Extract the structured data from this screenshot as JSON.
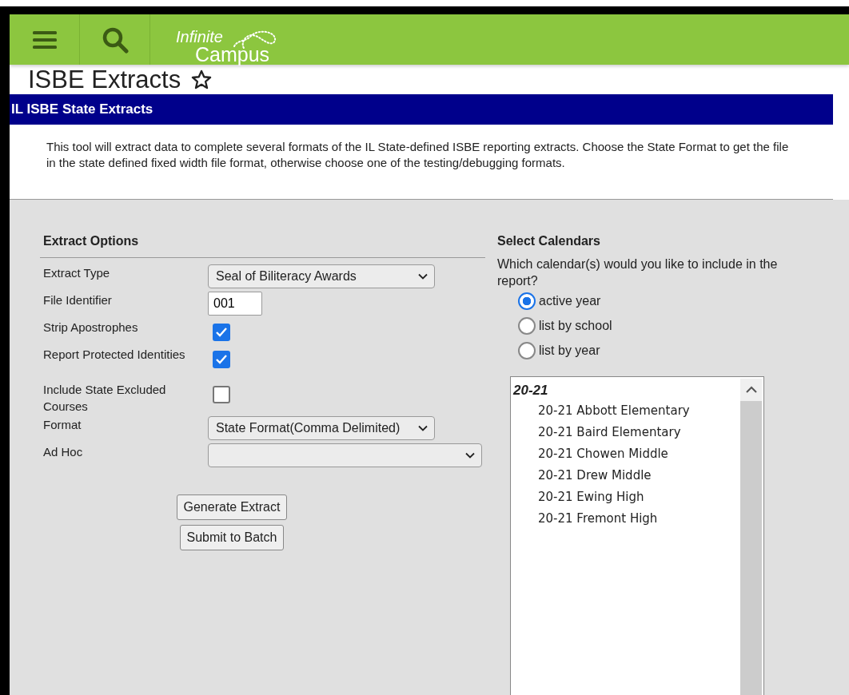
{
  "header": {
    "logo_line1": "Infinite",
    "logo_line2": "Campus"
  },
  "page": {
    "title": "ISBE Extracts",
    "favorited": false
  },
  "panel": {
    "title": "IL ISBE State Extracts",
    "description": "This tool will extract data to complete several formats of the IL State-defined ISBE reporting extracts. Choose the State Format to get the file in the state defined fixed width file format, otherwise choose one of the testing/debugging formats."
  },
  "extract_options": {
    "heading": "Extract Options",
    "fields": [
      {
        "kind": "select",
        "label": "Extract Type",
        "value": "Seal of Biliteracy Awards"
      },
      {
        "kind": "text",
        "label": "File Identifier",
        "value": "001"
      },
      {
        "kind": "checkbox",
        "label": "Strip Apostrophes",
        "checked": true
      },
      {
        "kind": "checkbox",
        "label": "Report Protected Identities",
        "checked": true
      },
      {
        "kind": "checkbox",
        "label": "Include State Excluded Courses",
        "checked": false
      },
      {
        "kind": "select",
        "label": "Format",
        "value": "State Format(Comma Delimited)"
      },
      {
        "kind": "select",
        "label": "Ad Hoc"
      }
    ],
    "buttons": [
      "Generate Extract",
      "Submit to Batch"
    ]
  },
  "calendars": {
    "heading": "Select Calendars",
    "question": "Which calendar(s) would you like to include in the report?",
    "options": [
      {
        "label": "active year",
        "selected": true
      },
      {
        "label": "list by school",
        "selected": false
      },
      {
        "label": "list by year",
        "selected": false
      }
    ],
    "list": {
      "group": "20-21",
      "items": [
        "20-21 Abbott Elementary",
        "20-21 Baird Elementary",
        "20-21 Chowen Middle",
        "20-21 Drew Middle",
        "20-21 Ewing High",
        "20-21 Fremont High"
      ]
    }
  }
}
